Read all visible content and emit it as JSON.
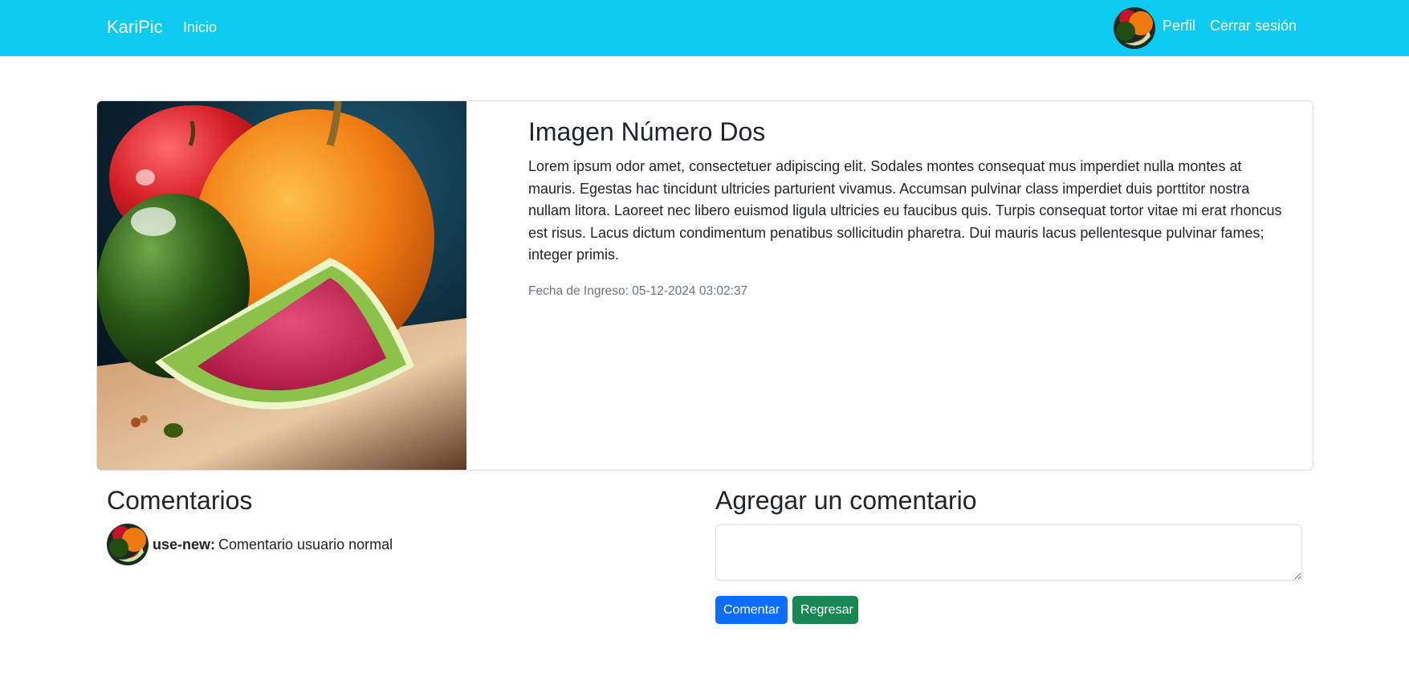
{
  "navbar": {
    "brand": "KariPic",
    "inicio": "Inicio",
    "perfil": "Perfil",
    "logout": "Cerrar sesión",
    "background_color": "#0dcaf0"
  },
  "image_card": {
    "title": "Imagen Número Dos",
    "description": "Lorem ipsum odor amet, consectetuer adipiscing elit. Sodales montes consequat mus imperdiet nulla montes at mauris. Egestas hac tincidunt ultricies parturient vivamus. Accumsan pulvinar class imperdiet duis porttitor nostra nullam litora. Laoreet nec libero euismod ligula ultricies eu faucibus quis. Turpis consequat tortor vitae mi erat rhoncus est risus. Lacus dictum condimentum penatibus sollicitudin pharetra. Dui mauris lacus pellentesque pulvinar fames; integer primis.",
    "date": "Fecha de Ingreso: 05-12-2024 03:02:37"
  },
  "comments": {
    "title": "Comentarios",
    "items": [
      {
        "user": "use-new:",
        "text": "Comentario usuario normal"
      }
    ]
  },
  "add_comment": {
    "title": "Agregar un comentario",
    "placeholder": "",
    "submit_label": "Comentar",
    "back_label": "Regresar"
  },
  "colors": {
    "primary": "#0d6efd",
    "success": "#198754",
    "muted": "#6c757d"
  }
}
